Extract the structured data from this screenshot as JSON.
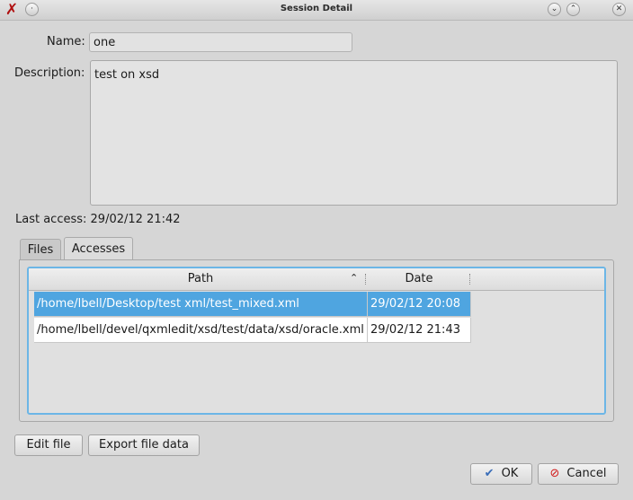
{
  "window": {
    "title": "Session Detail",
    "buttons": [
      "close",
      "minimize",
      "maximize"
    ]
  },
  "form": {
    "name_label": "Name:",
    "name_value": "one",
    "description_label": "Description:",
    "description_value": "test on xsd",
    "last_access_text": "Last access: 29/02/12 21:42"
  },
  "tabs": [
    {
      "label": "Files",
      "active": false
    },
    {
      "label": "Accesses",
      "active": true
    }
  ],
  "table": {
    "columns": [
      {
        "label": "Path",
        "sort": "ascending"
      },
      {
        "label": "Date"
      }
    ],
    "rows": [
      {
        "path": "/home/lbell/Desktop/test xml/test_mixed.xml",
        "date": "29/02/12 20:08",
        "selected": true
      },
      {
        "path": "/home/lbell/devel/qxmledit/xsd/test/data/xsd/oracle.xml",
        "date": "29/02/12 21:43",
        "selected": false
      }
    ]
  },
  "buttons": {
    "edit_file": "Edit file",
    "export_file_data": "Export file data",
    "ok": "OK",
    "cancel": "Cancel"
  },
  "icons": {
    "app": "x-logo-icon",
    "ok": "check-icon",
    "cancel": "cancel-icon",
    "sort": "sort-ascending-icon"
  },
  "colors": {
    "selection": "#4fa5e0",
    "focus_border": "#6cb6e6",
    "cancel_icon": "#d01818",
    "ok_icon": "#3a6db8"
  }
}
